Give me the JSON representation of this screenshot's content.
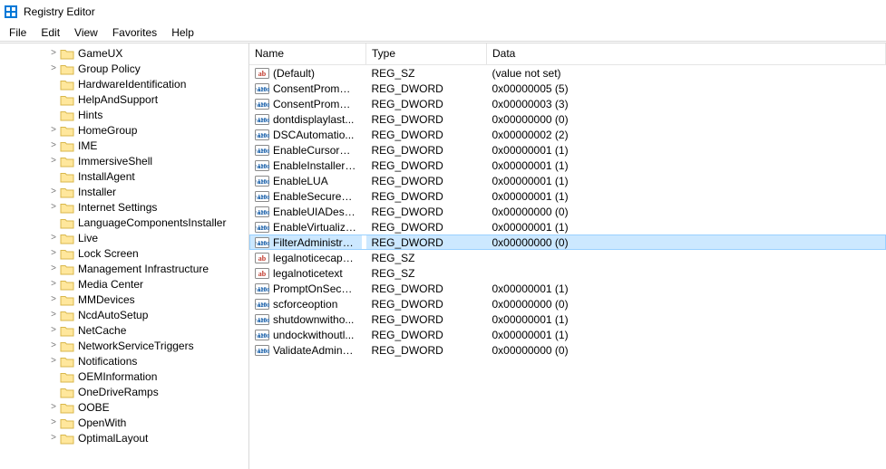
{
  "window": {
    "title": "Registry Editor"
  },
  "menu": {
    "items": [
      "File",
      "Edit",
      "View",
      "Favorites",
      "Help"
    ]
  },
  "tree": {
    "indent_base": 52,
    "items": [
      {
        "label": "GameUX",
        "expandable": true
      },
      {
        "label": "Group Policy",
        "expandable": true
      },
      {
        "label": "HardwareIdentification",
        "expandable": false
      },
      {
        "label": "HelpAndSupport",
        "expandable": false
      },
      {
        "label": "Hints",
        "expandable": false
      },
      {
        "label": "HomeGroup",
        "expandable": true
      },
      {
        "label": "IME",
        "expandable": true
      },
      {
        "label": "ImmersiveShell",
        "expandable": true
      },
      {
        "label": "InstallAgent",
        "expandable": false
      },
      {
        "label": "Installer",
        "expandable": true
      },
      {
        "label": "Internet Settings",
        "expandable": true
      },
      {
        "label": "LanguageComponentsInstaller",
        "expandable": false
      },
      {
        "label": "Live",
        "expandable": true
      },
      {
        "label": "Lock Screen",
        "expandable": true
      },
      {
        "label": "Management Infrastructure",
        "expandable": true
      },
      {
        "label": "Media Center",
        "expandable": true
      },
      {
        "label": "MMDevices",
        "expandable": true
      },
      {
        "label": "NcdAutoSetup",
        "expandable": true
      },
      {
        "label": "NetCache",
        "expandable": true
      },
      {
        "label": "NetworkServiceTriggers",
        "expandable": true
      },
      {
        "label": "Notifications",
        "expandable": true
      },
      {
        "label": "OEMInformation",
        "expandable": false
      },
      {
        "label": "OneDriveRamps",
        "expandable": false
      },
      {
        "label": "OOBE",
        "expandable": true
      },
      {
        "label": "OpenWith",
        "expandable": true
      },
      {
        "label": "OptimalLayout",
        "expandable": true
      }
    ]
  },
  "list": {
    "columns": [
      "Name",
      "Type",
      "Data"
    ],
    "rows": [
      {
        "icon": "sz",
        "name": "(Default)",
        "type": "REG_SZ",
        "data": "(value not set)",
        "selected": false
      },
      {
        "icon": "dw",
        "name": "ConsentPrompt...",
        "type": "REG_DWORD",
        "data": "0x00000005 (5)",
        "selected": false
      },
      {
        "icon": "dw",
        "name": "ConsentPrompt...",
        "type": "REG_DWORD",
        "data": "0x00000003 (3)",
        "selected": false
      },
      {
        "icon": "dw",
        "name": "dontdisplaylast...",
        "type": "REG_DWORD",
        "data": "0x00000000 (0)",
        "selected": false
      },
      {
        "icon": "dw",
        "name": "DSCAutomatio...",
        "type": "REG_DWORD",
        "data": "0x00000002 (2)",
        "selected": false
      },
      {
        "icon": "dw",
        "name": "EnableCursorSu...",
        "type": "REG_DWORD",
        "data": "0x00000001 (1)",
        "selected": false
      },
      {
        "icon": "dw",
        "name": "EnableInstallerD...",
        "type": "REG_DWORD",
        "data": "0x00000001 (1)",
        "selected": false
      },
      {
        "icon": "dw",
        "name": "EnableLUA",
        "type": "REG_DWORD",
        "data": "0x00000001 (1)",
        "selected": false
      },
      {
        "icon": "dw",
        "name": "EnableSecureUI...",
        "type": "REG_DWORD",
        "data": "0x00000001 (1)",
        "selected": false
      },
      {
        "icon": "dw",
        "name": "EnableUIADeskt...",
        "type": "REG_DWORD",
        "data": "0x00000000 (0)",
        "selected": false
      },
      {
        "icon": "dw",
        "name": "EnableVirtualiza...",
        "type": "REG_DWORD",
        "data": "0x00000001 (1)",
        "selected": false
      },
      {
        "icon": "dw",
        "name": "FilterAdministra...",
        "type": "REG_DWORD",
        "data": "0x00000000 (0)",
        "selected": true
      },
      {
        "icon": "sz",
        "name": "legalnoticecapti...",
        "type": "REG_SZ",
        "data": "",
        "selected": false
      },
      {
        "icon": "sz",
        "name": "legalnoticetext",
        "type": "REG_SZ",
        "data": "",
        "selected": false
      },
      {
        "icon": "dw",
        "name": "PromptOnSecur...",
        "type": "REG_DWORD",
        "data": "0x00000001 (1)",
        "selected": false
      },
      {
        "icon": "dw",
        "name": "scforceoption",
        "type": "REG_DWORD",
        "data": "0x00000000 (0)",
        "selected": false
      },
      {
        "icon": "dw",
        "name": "shutdownwitho...",
        "type": "REG_DWORD",
        "data": "0x00000001 (1)",
        "selected": false
      },
      {
        "icon": "dw",
        "name": "undockwithoutl...",
        "type": "REG_DWORD",
        "data": "0x00000001 (1)",
        "selected": false
      },
      {
        "icon": "dw",
        "name": "ValidateAdminC...",
        "type": "REG_DWORD",
        "data": "0x00000000 (0)",
        "selected": false
      }
    ]
  }
}
